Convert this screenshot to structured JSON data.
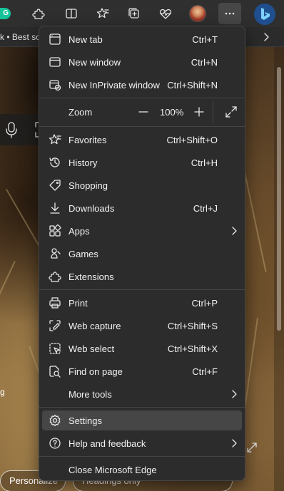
{
  "favorites_bar": {
    "visible_text": "k • Best sol"
  },
  "page": {
    "fragment_text": "g",
    "buttons": [
      "Personalize",
      "Headings only"
    ]
  },
  "menu": {
    "items": [
      {
        "label": "New tab",
        "shortcut": "Ctrl+T",
        "icon": "new-tab-icon"
      },
      {
        "label": "New window",
        "shortcut": "Ctrl+N",
        "icon": "new-window-icon"
      },
      {
        "label": "New InPrivate window",
        "shortcut": "Ctrl+Shift+N",
        "icon": "inprivate-icon"
      },
      {
        "label": "Favorites",
        "shortcut": "Ctrl+Shift+O",
        "icon": "star-icon"
      },
      {
        "label": "History",
        "shortcut": "Ctrl+H",
        "icon": "history-icon"
      },
      {
        "label": "Shopping",
        "shortcut": "",
        "icon": "tag-icon"
      },
      {
        "label": "Downloads",
        "shortcut": "Ctrl+J",
        "icon": "download-icon"
      },
      {
        "label": "Apps",
        "shortcut": "",
        "icon": "apps-icon"
      },
      {
        "label": "Games",
        "shortcut": "",
        "icon": "games-icon"
      },
      {
        "label": "Extensions",
        "shortcut": "",
        "icon": "puzzle-icon"
      },
      {
        "label": "Print",
        "shortcut": "Ctrl+P",
        "icon": "print-icon"
      },
      {
        "label": "Web capture",
        "shortcut": "Ctrl+Shift+S",
        "icon": "web-capture-icon"
      },
      {
        "label": "Web select",
        "shortcut": "Ctrl+Shift+X",
        "icon": "web-select-icon"
      },
      {
        "label": "Find on page",
        "shortcut": "Ctrl+F",
        "icon": "find-icon"
      },
      {
        "label": "More tools",
        "shortcut": "",
        "icon": ""
      },
      {
        "label": "Settings",
        "shortcut": "",
        "icon": "gear-icon"
      },
      {
        "label": "Help and feedback",
        "shortcut": "",
        "icon": "help-icon"
      },
      {
        "label": "Close Microsoft Edge",
        "shortcut": "",
        "icon": ""
      }
    ],
    "zoom": {
      "label": "Zoom",
      "value": "100%"
    },
    "hovered_item": "Settings"
  }
}
